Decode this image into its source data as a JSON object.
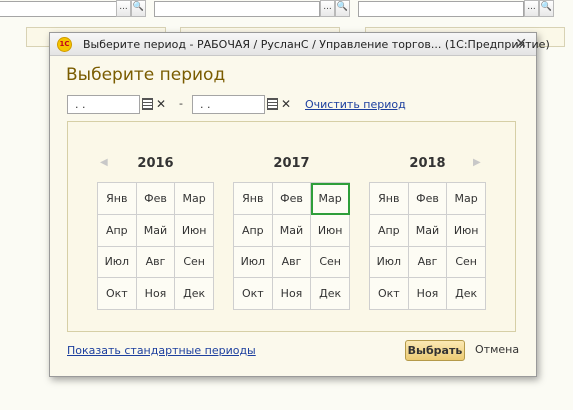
{
  "background": {
    "field_button_dots": "...",
    "field_button_search": "🔍"
  },
  "dialog": {
    "window_title": "Выберите период - РАБОЧАЯ / РусланС / Управление торгов... (1С:Предприятие)",
    "logo_text": "1С",
    "close_glyph": "✕",
    "heading": "Выберите период",
    "period_start_value": ". .",
    "period_end_value": ". .",
    "dash": "-",
    "clear_glyph": "✕",
    "clear_period_link": "Очистить период",
    "prev_arrow": "◀",
    "next_arrow": "▶",
    "years": [
      {
        "label": "2016",
        "months": [
          "Янв",
          "Фев",
          "Мар",
          "Апр",
          "Май",
          "Июн",
          "Июл",
          "Авг",
          "Сен",
          "Окт",
          "Ноя",
          "Дек"
        ]
      },
      {
        "label": "2017",
        "months": [
          "Янв",
          "Фев",
          "Мар",
          "Апр",
          "Май",
          "Июн",
          "Июл",
          "Авг",
          "Сен",
          "Окт",
          "Ноя",
          "Дек"
        ],
        "selected_month": "Мар"
      },
      {
        "label": "2018",
        "months": [
          "Янв",
          "Фев",
          "Мар",
          "Апр",
          "Май",
          "Июн",
          "Июл",
          "Авг",
          "Сен",
          "Окт",
          "Ноя",
          "Дек"
        ]
      }
    ],
    "standard_periods_link": "Показать стандартные периоды",
    "select_button": "Выбрать",
    "cancel_button": "Отмена"
  },
  "colors": {
    "accent_heading": "#7a5c00",
    "selected_outline": "#2e9e3a",
    "link": "#1c3f9e"
  }
}
